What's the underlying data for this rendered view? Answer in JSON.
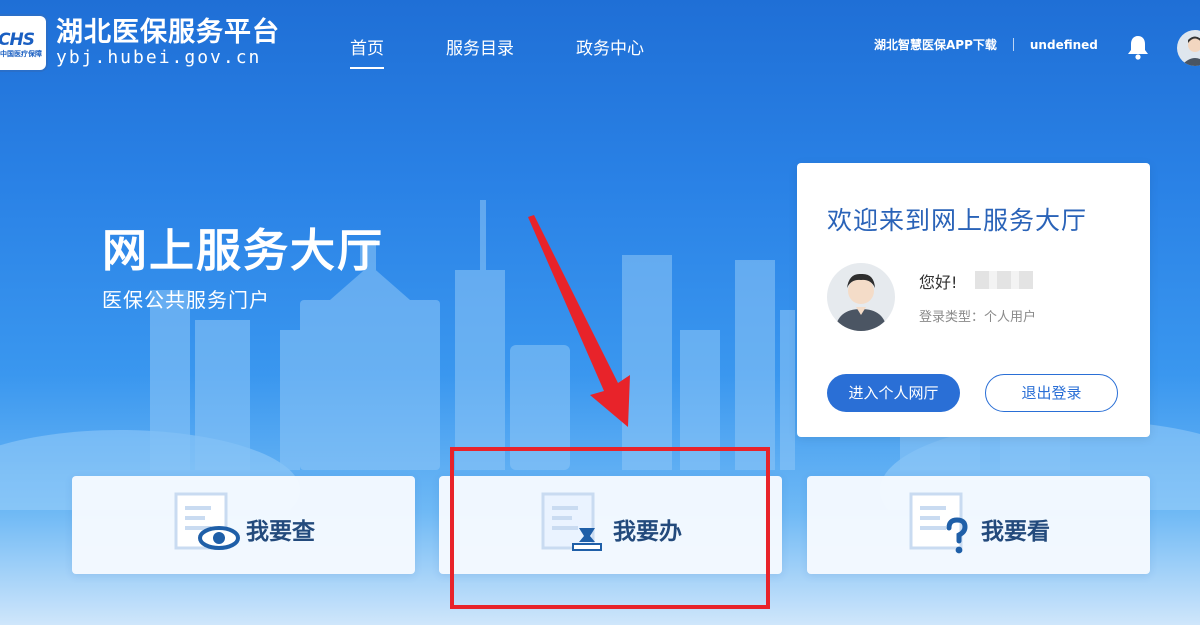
{
  "header": {
    "logo_text": "CHS",
    "logo_subtext": "中国医疗保障",
    "site_name": "湖北医保服务平台",
    "site_url": "ybj.hubei.gov.cn",
    "nav": [
      "首页",
      "服务目录",
      "政务中心"
    ],
    "active_nav": "首页",
    "app_download": "湖北智慧医保APP下载",
    "user_label": "undefined"
  },
  "hero": {
    "title": "网上服务大厅",
    "subtitle": "医保公共服务门户"
  },
  "welcome_card": {
    "title": "欢迎来到网上服务大厅",
    "greeting": "您好!",
    "login_type": "登录类型：个人用户",
    "enter_button": "进入个人网厅",
    "logout_button": "退出登录"
  },
  "services": [
    {
      "label": "我要查",
      "icon": "document-eye-icon"
    },
    {
      "label": "我要办",
      "icon": "document-stamp-icon"
    },
    {
      "label": "我要看",
      "icon": "document-question-icon"
    }
  ],
  "colors": {
    "primary": "#2a6fd6",
    "annotation": "#e8232a",
    "card_title": "#2a63b8"
  }
}
